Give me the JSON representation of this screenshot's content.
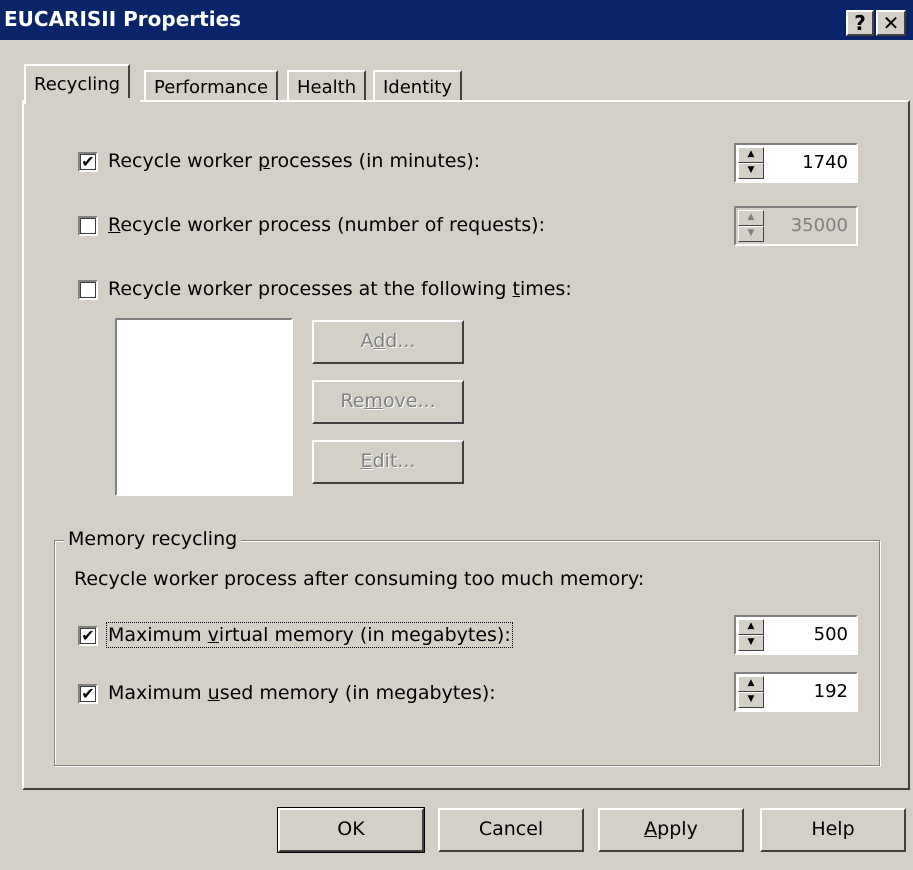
{
  "window": {
    "title": "EUCARISII Properties",
    "help_glyph": "?",
    "close_glyph": "✕"
  },
  "tabs": [
    {
      "label": "Recycling",
      "active": true
    },
    {
      "label": "Performance",
      "active": false
    },
    {
      "label": "Health",
      "active": false
    },
    {
      "label": "Identity",
      "active": false
    }
  ],
  "recycling": {
    "minutes": {
      "label_pre": "Recycle worker ",
      "label_ul": "p",
      "label_post": "rocesses (in minutes):",
      "checked": true,
      "value": "1740"
    },
    "requests": {
      "label_pre": "",
      "label_ul": "R",
      "label_post": "ecycle worker process (number of requests):",
      "checked": false,
      "value": "35000"
    },
    "times": {
      "label_pre": "Recycle worker processes at the following ",
      "label_ul": "t",
      "label_post": "imes:",
      "checked": false
    },
    "add_button": {
      "pre": "A",
      "ul": "d",
      "post": "d..."
    },
    "remove_button": {
      "pre": "Re",
      "ul": "m",
      "post": "ove..."
    },
    "edit_button": {
      "pre": "",
      "ul": "E",
      "post": "dit..."
    }
  },
  "memory": {
    "group_title": "Memory recycling",
    "description": "Recycle worker process after consuming too much memory:",
    "virtual": {
      "label_pre": "Maximum ",
      "label_ul": "v",
      "label_post": "irtual memory (in megabytes):",
      "checked": true,
      "value": "500"
    },
    "used": {
      "label_pre": "Maximum ",
      "label_ul": "u",
      "label_post": "sed memory (in megabytes):",
      "checked": true,
      "value": "192"
    }
  },
  "footer": {
    "ok": "OK",
    "cancel": "Cancel",
    "apply_ul": "A",
    "apply_post": "pply",
    "help": "Help"
  },
  "check_glyph": "✔"
}
